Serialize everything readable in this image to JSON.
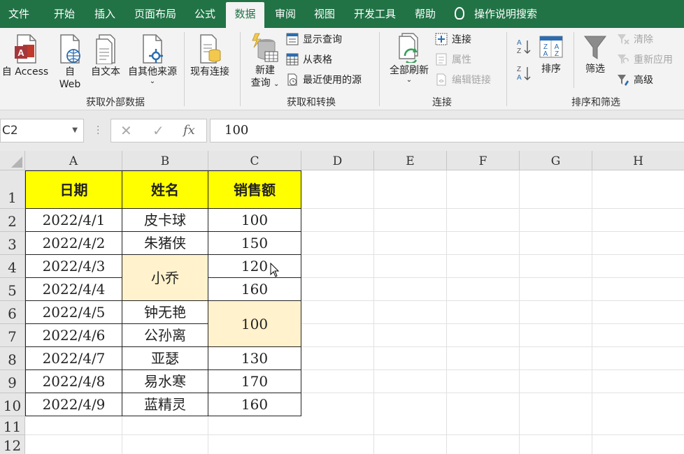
{
  "tabs": [
    {
      "label": "文件"
    },
    {
      "label": "开始"
    },
    {
      "label": "插入"
    },
    {
      "label": "页面布局"
    },
    {
      "label": "公式"
    },
    {
      "label": "数据"
    },
    {
      "label": "审阅"
    },
    {
      "label": "视图"
    },
    {
      "label": "开发工具"
    },
    {
      "label": "帮助"
    }
  ],
  "active_tab": "数据",
  "tell_me": "操作说明搜索",
  "ribbon": {
    "get_external": {
      "from_access_1": "自 Access",
      "from_web_1": "自",
      "from_web_2": "Web",
      "from_text": "自文本",
      "from_other": "自其他来源",
      "existing_conn": "现有连接",
      "group_label": "获取外部数据"
    },
    "get_transform": {
      "new_query_1": "新建",
      "new_query_2": "查询",
      "show_queries": "显示查询",
      "from_table": "从表格",
      "recent_sources": "最近使用的源",
      "group_label": "获取和转换"
    },
    "connections": {
      "refresh_all": "全部刷新",
      "connections": "连接",
      "properties": "属性",
      "edit_links": "编辑链接",
      "group_label": "连接"
    },
    "sort_filter": {
      "sort": "排序",
      "filter": "筛选",
      "clear": "清除",
      "reapply": "重新应用",
      "advanced": "高级",
      "group_label": "排序和筛选"
    }
  },
  "formula_bar": {
    "name_box": "C2",
    "fx": "fx",
    "value": "100"
  },
  "columns": [
    "A",
    "B",
    "C",
    "D",
    "E",
    "F",
    "G",
    "H"
  ],
  "rows": [
    "1",
    "2",
    "3",
    "4",
    "5",
    "6",
    "7",
    "8",
    "9",
    "10",
    "11",
    "12"
  ],
  "table": {
    "headers": [
      "日期",
      "姓名",
      "销售额"
    ],
    "dates": [
      "2022/4/1",
      "2022/4/2",
      "2022/4/3",
      "2022/4/4",
      "2022/4/5",
      "2022/4/6",
      "2022/4/7",
      "2022/4/8",
      "2022/4/9"
    ],
    "names": [
      "皮卡球",
      "朱猪侠",
      "小乔",
      "钟无艳",
      "公孙离",
      "亚瑟",
      "易水寒",
      "蓝精灵"
    ],
    "sales": [
      "100",
      "150",
      "120",
      "160",
      "100",
      "130",
      "170",
      "160"
    ]
  },
  "colors": {
    "accent": "#217346",
    "header_fill": "#ffff00",
    "merged_fill": "#fff2cc"
  }
}
